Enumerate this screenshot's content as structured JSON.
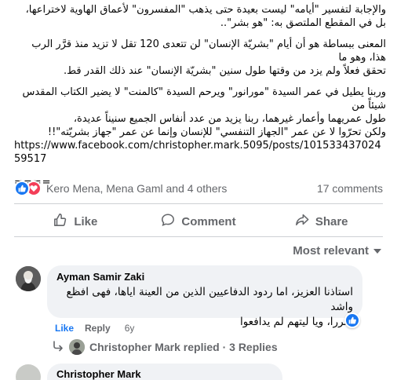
{
  "post": {
    "paragraphs": [
      [
        "والإجابة لتفسير \"أيامه\" ليست بعيدة حتى يذهب \"المفسرون\" لأعماق الهاوية لاختراعها،",
        "بل في المقطع الملتصق به: \"هو بشر\".."
      ],
      [
        "المعنى ببساطة هو أن أيام \"بشريّة الإنسان\" لن تتعدى 120 تقل لا تزيد منذ قرَّر الرب هذا، وهو ما",
        "تحقق فعلاً ولم يزد من وقتها طول سنين \"بشريّة الإنسان\" عند ذلك القدر قط."
      ],
      [
        "وربنا يطيل في عمر السيدة \"مورانور\" ويرحم السيدة \"كالمنت\" لا يضير الكتاب المقدس شيئاً من",
        "طول عمريهما وأعمار غيرهما، ربنا يزيد من عدد أنفاس الجميع سنيناً عديدة،",
        "ولكن تحرّوا لا عن عمر \"الجهاز التنفسي\" للإنسان وإنما عن عمر \"جهاز بشريّته\"!!"
      ]
    ],
    "link": "https://www.facebook.com/christopher.mark.5095/posts/10153343702459517",
    "separator": "===="
  },
  "stats": {
    "reactors": "Kero Mena, Mena Gaml and 4 others",
    "comments": "17 comments"
  },
  "actions": {
    "like": "Like",
    "comment": "Comment",
    "share": "Share"
  },
  "sort": {
    "label": "Most relevant"
  },
  "comment": {
    "author": "Ayman Samir Zaki",
    "lines": [
      "استاذنا العزيز، اما ردود الدفاعيين الذين من العينة اياها، فهى افظع واشد",
      "ضررا، ويا ليتهم لم يدافعوا"
    ],
    "like_label": "Like",
    "reply_label": "Reply",
    "age": "6y"
  },
  "replies": {
    "label": "Christopher Mark replied · 3 Replies"
  },
  "next_comment": {
    "author": "Christopher Mark"
  },
  "colors": {
    "link_blue": "#1877f2",
    "love_red": "#f33e58",
    "muted": "#65676b",
    "bubble": "#f0f2f5"
  }
}
